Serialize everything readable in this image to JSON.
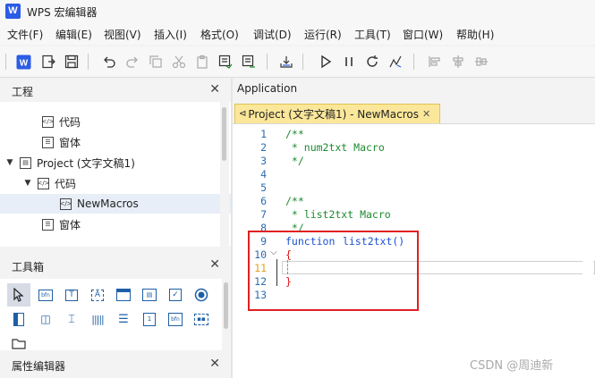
{
  "window": {
    "title": "WPS 宏编辑器",
    "logo_letter": "W"
  },
  "menu": [
    "文件(F)",
    "编辑(E)",
    "视图(V)",
    "插入(I)",
    "格式(O)",
    "调试(D)",
    "运行(R)",
    "工具(T)",
    "窗口(W)",
    "帮助(H)"
  ],
  "panels": {
    "project": {
      "title": "工程",
      "close": "✕"
    },
    "toolbox": {
      "title": "工具箱",
      "close": "✕"
    },
    "properties": {
      "title": "属性编辑器",
      "close": "✕"
    }
  },
  "tree": [
    {
      "label": "代码",
      "icon": "code-module-icon"
    },
    {
      "label": "窗体",
      "icon": "form-module-icon"
    },
    {
      "label": "Project (文字文稿1)",
      "icon": "project-icon"
    },
    {
      "label": "代码",
      "icon": "code-module-icon"
    },
    {
      "label": "NewMacros",
      "icon": "code-module-icon"
    },
    {
      "label": "窗体",
      "icon": "form-module-icon"
    }
  ],
  "editor": {
    "application_node": "Application",
    "tab": {
      "label": "Project (文字文稿1) - NewMacros",
      "close": "✕"
    },
    "lines": [
      "1",
      "2",
      "3",
      "4",
      "5",
      "6",
      "7",
      "8",
      "9",
      "10",
      "11",
      "12",
      "13"
    ],
    "code": {
      "c1": "/**",
      "c2": " * num2txt Macro",
      "c3": " */",
      "c6": "/**",
      "c7": " * list2txt Macro",
      "c8": " */",
      "c9_kw": "function",
      "c9_fn": "list2txt()",
      "c10": "{",
      "c12": "}"
    }
  },
  "watermark": "CSDN @周迪新",
  "colors": {
    "accent": "#2b5ce6",
    "tab_bg": "#fbe79a",
    "highlight": "#e02020",
    "comment": "#1c8a2e",
    "keyword": "#1b4fd1"
  }
}
